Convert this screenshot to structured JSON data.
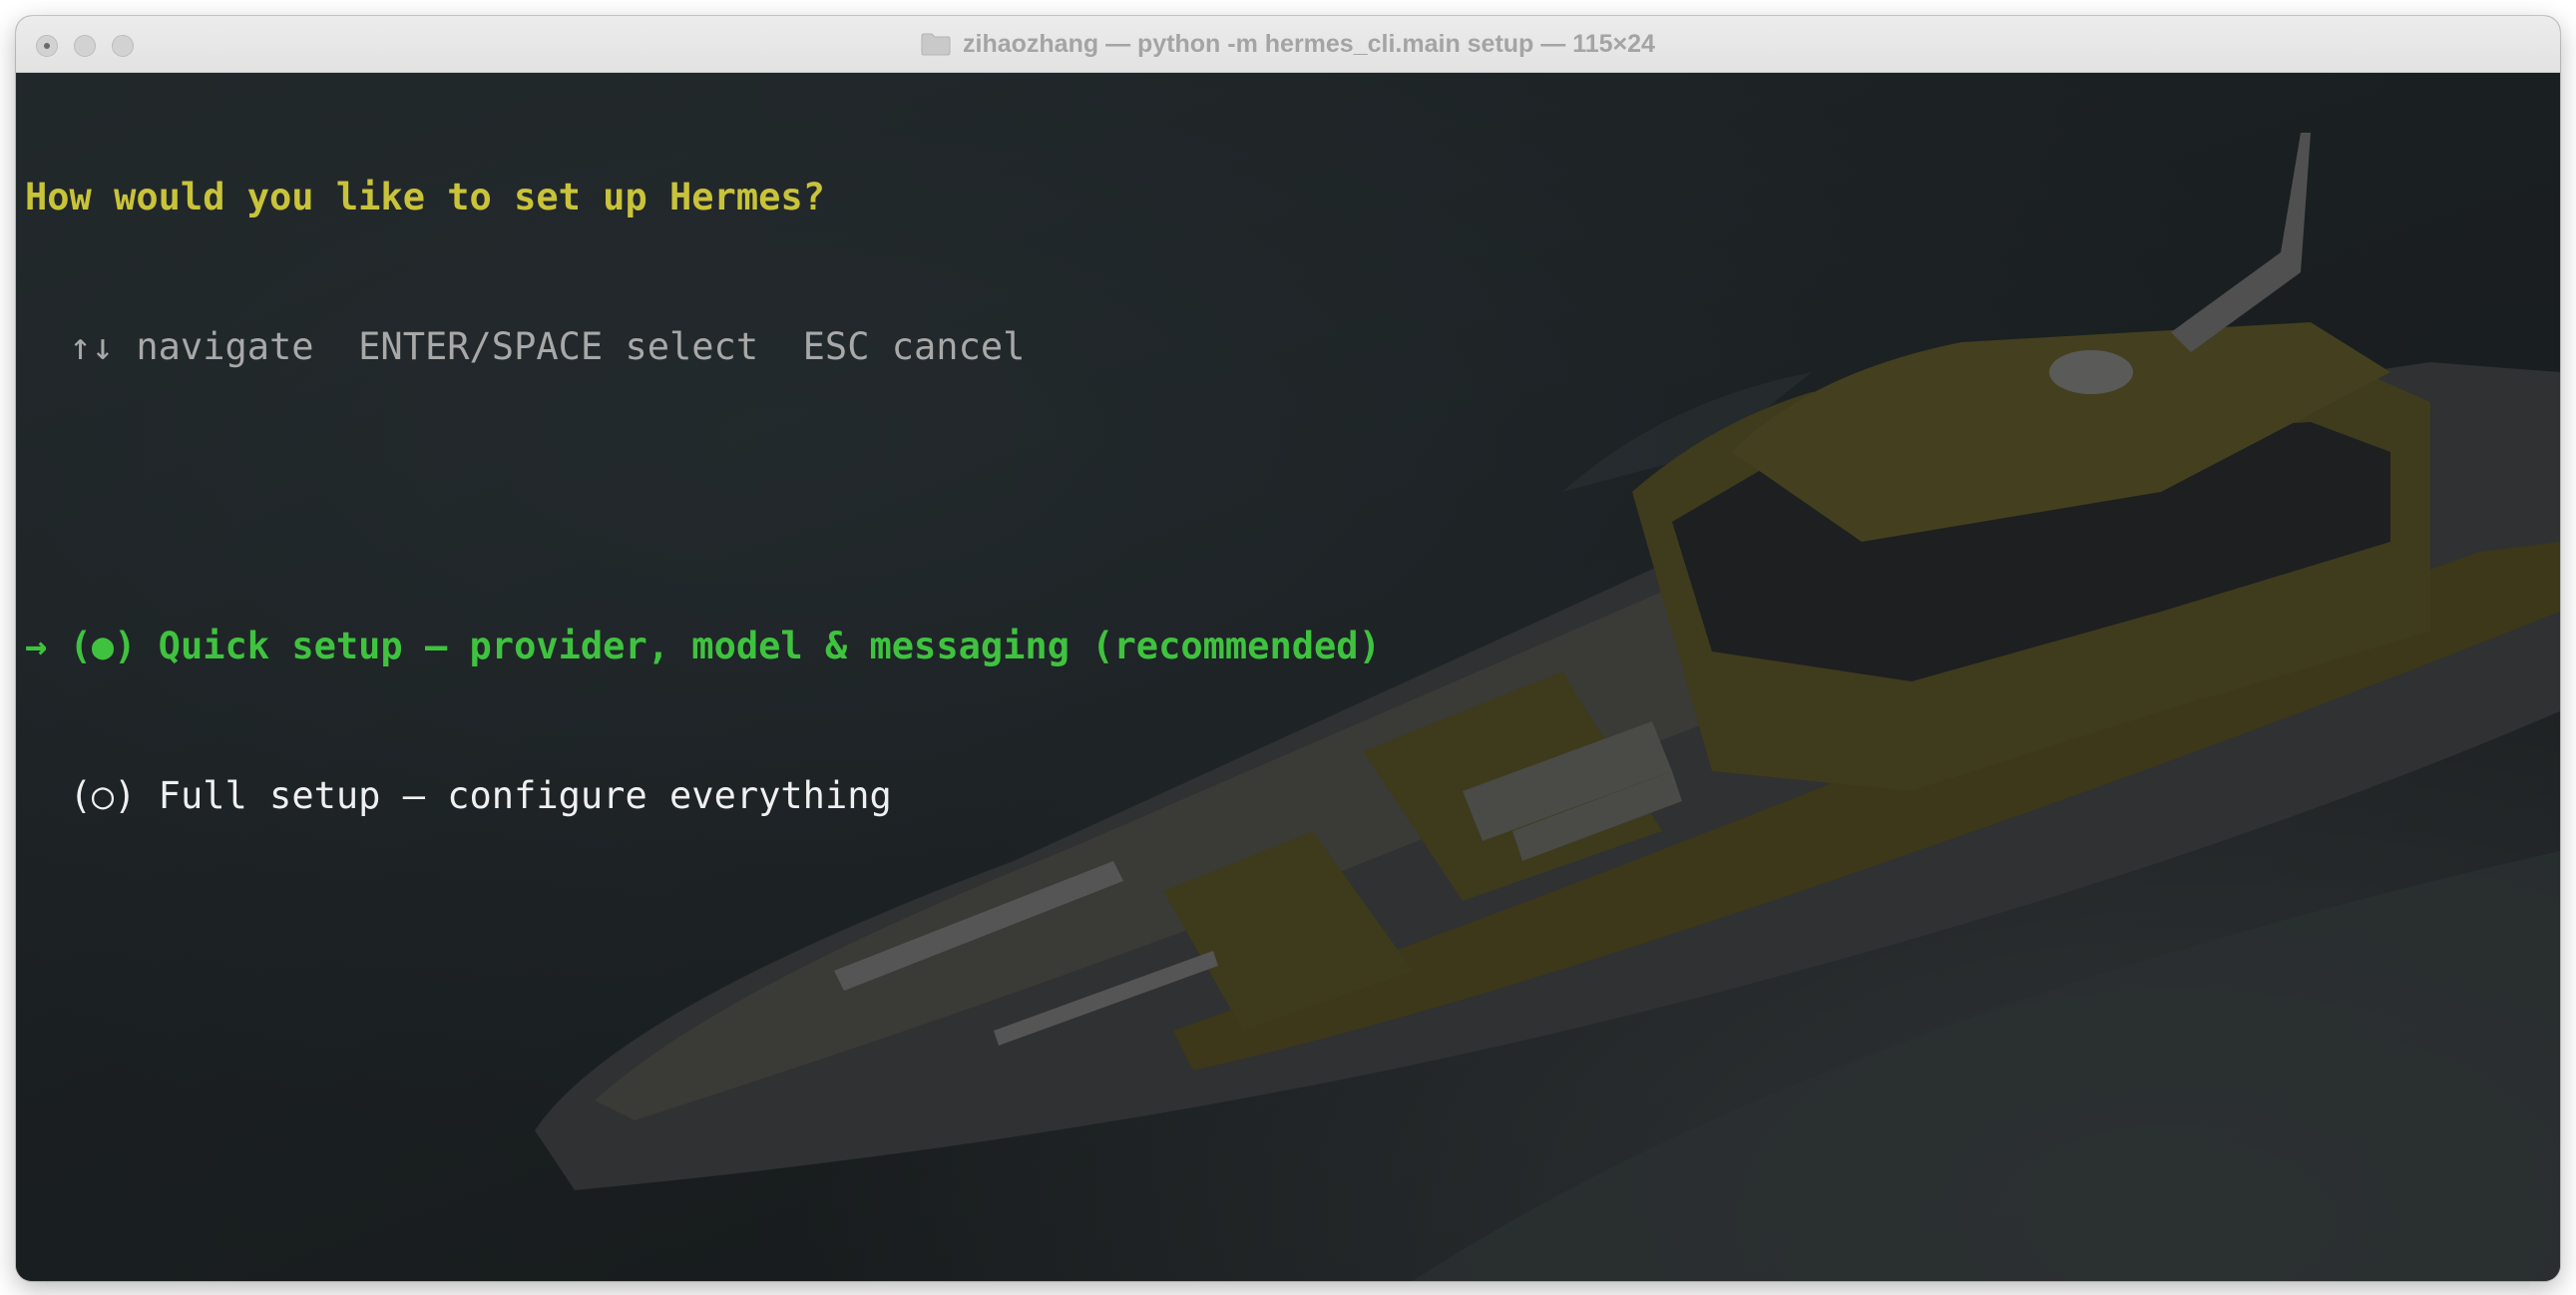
{
  "window": {
    "title": "zihaozhang — python -m hermes_cli.main setup — 115×24",
    "title_icon": "folder-icon"
  },
  "terminal": {
    "prompt": "How would you like to set up Hermes?",
    "hint": "  ↑↓ navigate  ENTER/SPACE select  ESC cancel",
    "options": [
      {
        "cursor": "→ ",
        "radio": "(●)",
        "label": " Quick setup — provider, model & messaging (recommended)",
        "selected": true
      },
      {
        "cursor": "  ",
        "radio": "(○)",
        "label": " Full setup — configure everything",
        "selected": false
      }
    ]
  },
  "colors": {
    "prompt": "#c9c33a",
    "hint": "#a8a8a8",
    "selected": "#3fc33f",
    "unselected": "#f0f0f0",
    "background": "#1b1e20"
  }
}
